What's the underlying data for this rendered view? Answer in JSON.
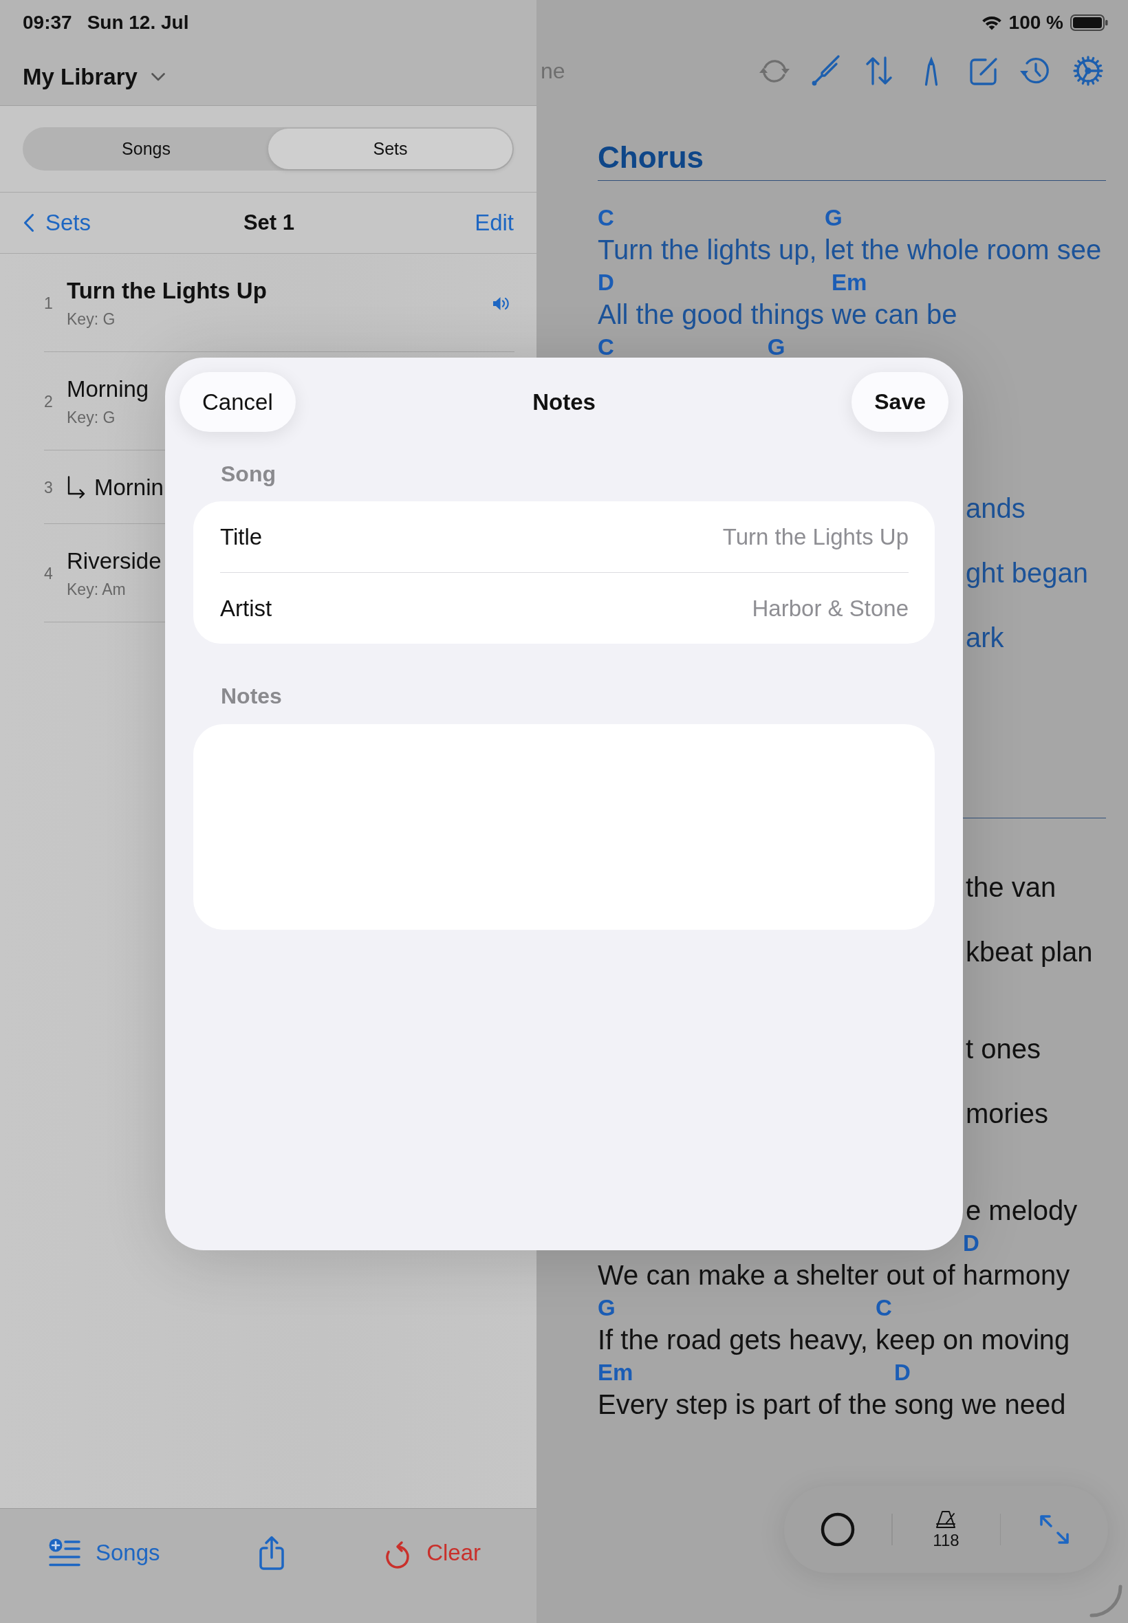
{
  "status_bar": {
    "time": "09:37",
    "date": "Sun 12. Jul",
    "battery": "100 %"
  },
  "sidebar": {
    "library": "My Library",
    "segments": [
      {
        "label": "Songs",
        "selected": false
      },
      {
        "label": "Sets",
        "selected": true
      }
    ],
    "nav": {
      "back": "Sets",
      "title": "Set 1",
      "action": "Edit"
    },
    "set_items": [
      {
        "number": "1",
        "kind": "song",
        "title": "Turn the Lights Up",
        "key": "Key: G",
        "selected": true,
        "audio": true
      },
      {
        "number": "2",
        "kind": "song",
        "title": "Morning",
        "key": "Key: G",
        "selected": false
      },
      {
        "number": "3",
        "kind": "segue",
        "title": "Mornin",
        "selected": false
      },
      {
        "number": "4",
        "kind": "song",
        "title": "Riverside",
        "key": "Key: Am",
        "selected": false
      }
    ],
    "toolbar": [
      {
        "kind": "add-songs",
        "label": "Songs"
      },
      {
        "kind": "share"
      },
      {
        "kind": "clear",
        "label": "Clear"
      }
    ]
  },
  "main": {
    "toolbar": {
      "label": "ne",
      "tools": [
        {
          "kind": "sync",
          "disabled": true
        },
        {
          "kind": "tuning-fork",
          "disabled": false
        },
        {
          "kind": "up-down-arrows",
          "disabled": false
        },
        {
          "kind": "compass",
          "disabled": false
        },
        {
          "kind": "compose",
          "disabled": false
        },
        {
          "kind": "clock",
          "disabled": false
        },
        {
          "kind": "gear",
          "disabled": false
        }
      ]
    },
    "sheet": {
      "sections": [
        {
          "kind": "chorus",
          "heading": "Chorus",
          "stanzas": [
            [
              {
                "kind": "full",
                "segments": [
                  {
                    "chord": "C",
                    "lyric": "Turn the lights up, "
                  },
                  {
                    "chord": "G",
                    "lyric": "let the whole room see"
                  }
                ]
              },
              {
                "kind": "full",
                "segments": [
                  {
                    "chord": "D",
                    "lyric": "All the good things "
                  },
                  {
                    "chord": "Em",
                    "lyric": "we can be"
                  }
                ]
              },
              {
                "kind": "chords",
                "segments": [
                  {
                    "chord": "C"
                  },
                  {
                    "chord": "G"
                  }
                ]
              },
              {
                "kind": "tail",
                "lyric": "ands"
              },
              {
                "kind": "tail",
                "lyric": "ght began"
              },
              {
                "kind": "tail",
                "lyric": "ark"
              }
            ]
          ]
        },
        {
          "kind": "verse",
          "stanzas": [
            [
              {
                "kind": "tail",
                "lyric": "the van"
              },
              {
                "kind": "tail",
                "lyric": "kbeat plan"
              }
            ],
            [
              {
                "kind": "tail",
                "lyric": "t ones"
              },
              {
                "kind": "tail",
                "lyric": "mories"
              }
            ],
            [
              {
                "kind": "tail",
                "lyric": "e melody"
              },
              {
                "kind": "full",
                "segments": [
                  {
                    "lyric": "We can make a shelter out of "
                  },
                  {
                    "chord": "D",
                    "lyric": "harmony"
                  }
                ]
              },
              {
                "kind": "full",
                "segments": [
                  {
                    "chord": "G",
                    "lyric": "If the road gets heavy, "
                  },
                  {
                    "chord": "C",
                    "lyric": "keep on moving"
                  }
                ]
              },
              {
                "kind": "full",
                "segments": [
                  {
                    "chord": "Em",
                    "lyric": "Every step is part of the "
                  },
                  {
                    "chord": "D",
                    "lyric": "song we need"
                  }
                ]
              }
            ]
          ]
        }
      ]
    },
    "controls": [
      {
        "kind": "ring"
      },
      {
        "kind": "metronome",
        "label": "118"
      },
      {
        "kind": "expand"
      }
    ]
  },
  "notes_sheet": {
    "title": "Notes",
    "cancel": "Cancel",
    "save": "Save",
    "song_section": {
      "label": "Song",
      "rows": [
        {
          "label": "Title",
          "value": "Turn the Lights Up"
        },
        {
          "label": "Artist",
          "value": "Harbor & Stone"
        }
      ]
    },
    "notes_section": {
      "label": "Notes"
    }
  }
}
